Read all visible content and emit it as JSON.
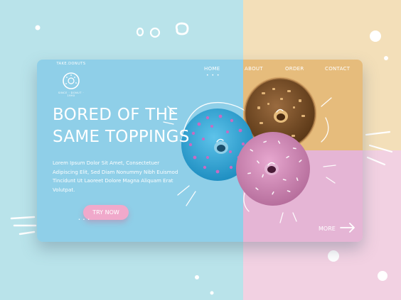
{
  "brand": {
    "logo_text": "TAKE.DONUTS",
    "logo_sub": "SINCE · DONUT · 1990"
  },
  "nav": {
    "home": "HOME",
    "about": "ABOUT",
    "order": "ORDER",
    "contact": "CONTACT",
    "active_indicator": "• • •"
  },
  "hero": {
    "headline_line1": "BORED OF THE",
    "headline_line2": "SAME TOPPINGS",
    "body": "Lorem Ipsum Dolor Sit Amet, Consectetuer Adipiscing Elit, Sed Diam Nonummy Nibh Euismod Tincidunt Ut Laoreet Dolore Magna Aliquam Erat Volutpat.",
    "cta_label": "TRY NOW",
    "cta_dots": "• • •"
  },
  "footer": {
    "more_label": "MORE"
  },
  "colors": {
    "bg_blue": "#b9e3ea",
    "bg_peach": "#f3dfb9",
    "bg_pink": "#f2d1e2",
    "card_blue": "#8fcfe8",
    "card_orange": "#e6bc7c",
    "card_pink": "#e5b5d5",
    "button_pink": "#f0a9cb"
  },
  "icons": {
    "more": "arrow-right-icon",
    "logo": "donut-logo-icon"
  }
}
